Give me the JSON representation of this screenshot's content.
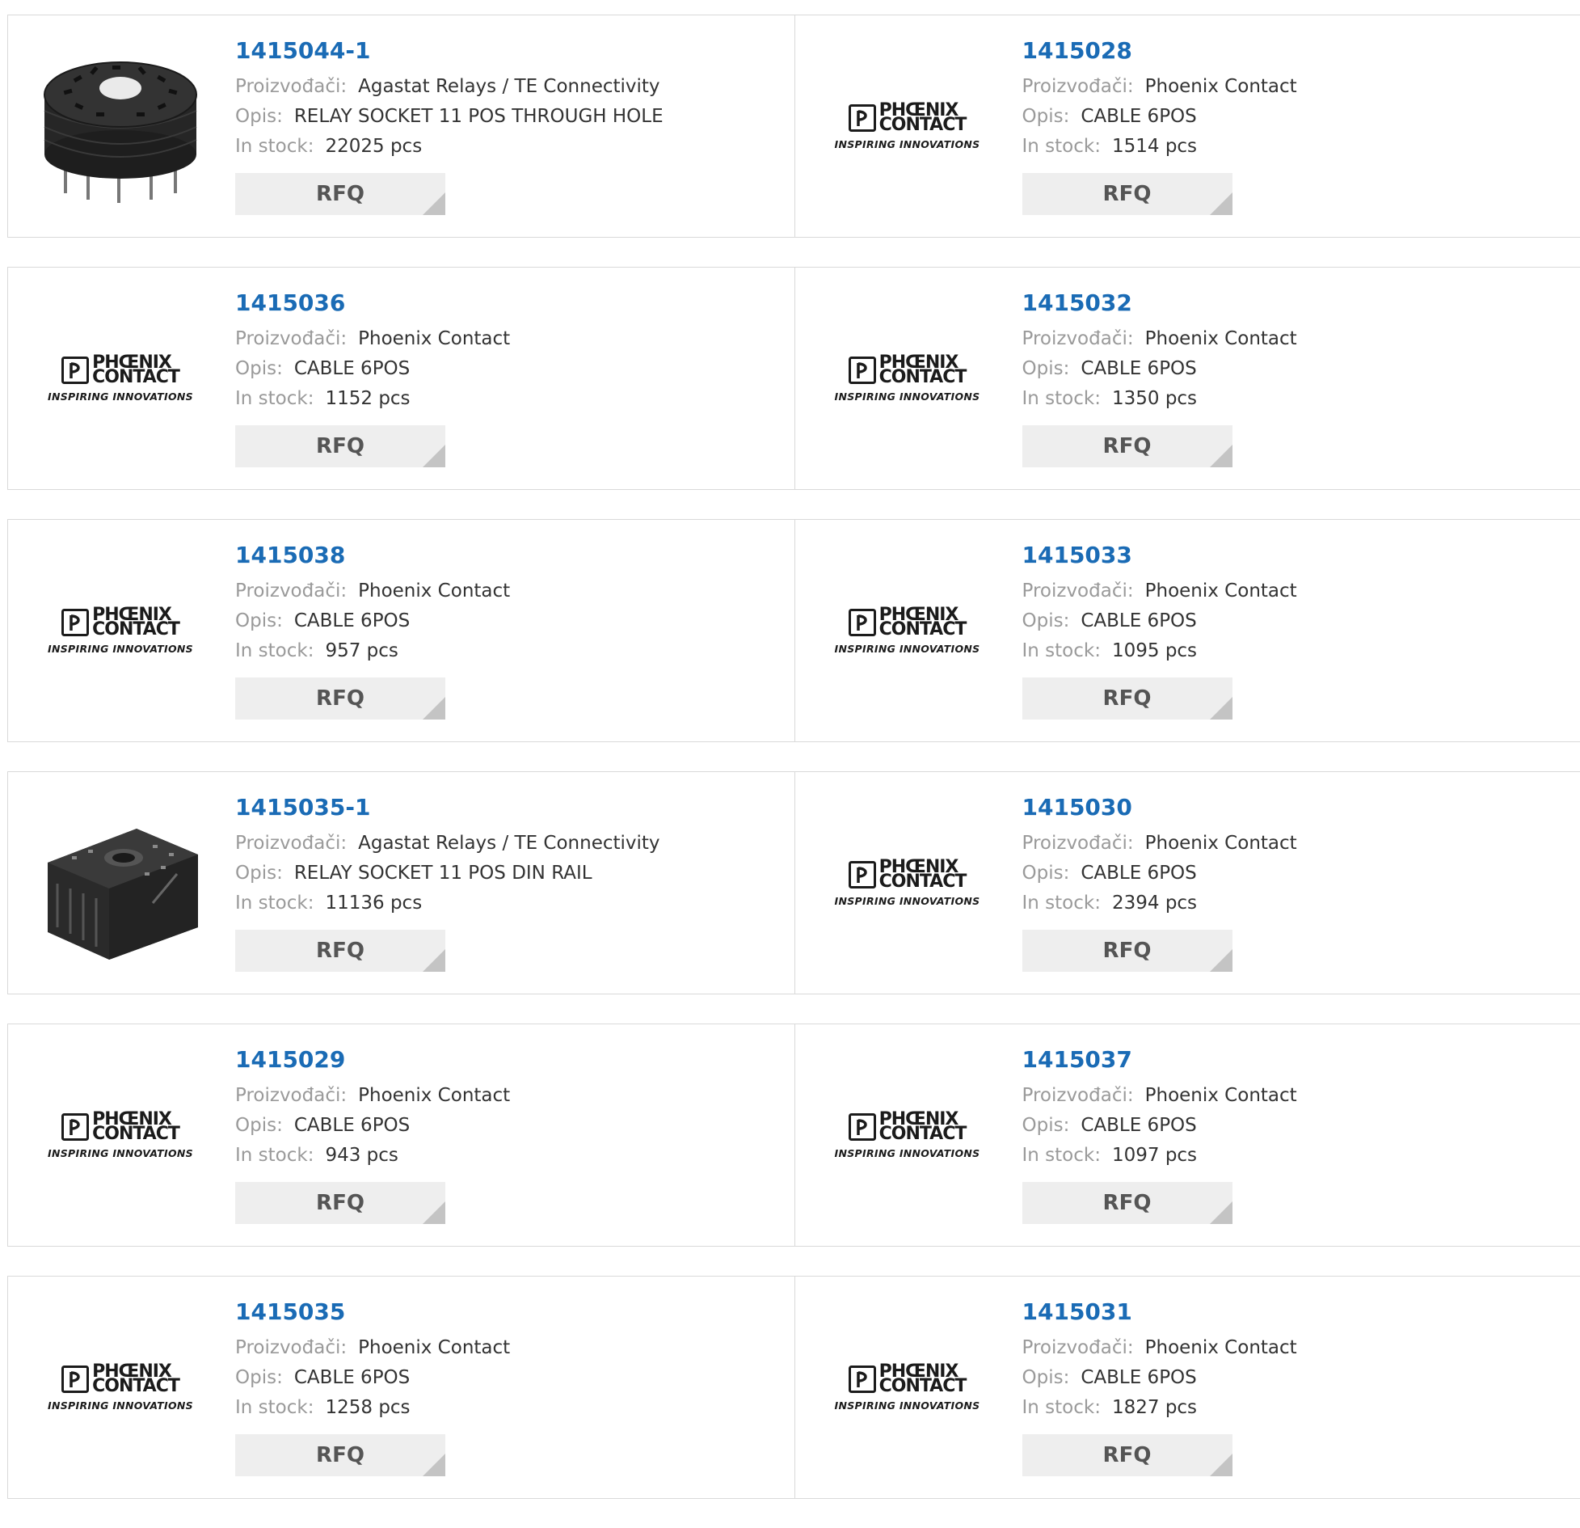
{
  "labels": {
    "manufacturer": "Proizvođači:",
    "description": "Opis:",
    "stock": "In stock:",
    "rfq": "RFQ"
  },
  "logo": {
    "brand_line1": "PHŒNIX",
    "brand_line2": "CONTACT",
    "tagline": "INSPIRING INNOVATIONS"
  },
  "products": [
    {
      "part_number": "1415044-1",
      "manufacturer": "Agastat Relays / TE Connectivity",
      "description": "RELAY SOCKET 11 POS THROUGH HOLE",
      "stock": "22025 pcs",
      "image": "relay-socket-round"
    },
    {
      "part_number": "1415028",
      "manufacturer": "Phoenix Contact",
      "description": "CABLE 6POS",
      "stock": "1514 pcs",
      "image": "phoenix-logo"
    },
    {
      "part_number": "1415036",
      "manufacturer": "Phoenix Contact",
      "description": "CABLE 6POS",
      "stock": "1152 pcs",
      "image": "phoenix-logo"
    },
    {
      "part_number": "1415032",
      "manufacturer": "Phoenix Contact",
      "description": "CABLE 6POS",
      "stock": "1350 pcs",
      "image": "phoenix-logo"
    },
    {
      "part_number": "1415038",
      "manufacturer": "Phoenix Contact",
      "description": "CABLE 6POS",
      "stock": "957 pcs",
      "image": "phoenix-logo"
    },
    {
      "part_number": "1415033",
      "manufacturer": "Phoenix Contact",
      "description": "CABLE 6POS",
      "stock": "1095 pcs",
      "image": "phoenix-logo"
    },
    {
      "part_number": "1415035-1",
      "manufacturer": "Agastat Relays / TE Connectivity",
      "description": "RELAY SOCKET 11 POS DIN RAIL",
      "stock": "11136 pcs",
      "image": "relay-socket-din"
    },
    {
      "part_number": "1415030",
      "manufacturer": "Phoenix Contact",
      "description": "CABLE 6POS",
      "stock": "2394 pcs",
      "image": "phoenix-logo"
    },
    {
      "part_number": "1415029",
      "manufacturer": "Phoenix Contact",
      "description": "CABLE 6POS",
      "stock": "943 pcs",
      "image": "phoenix-logo"
    },
    {
      "part_number": "1415037",
      "manufacturer": "Phoenix Contact",
      "description": "CABLE 6POS",
      "stock": "1097 pcs",
      "image": "phoenix-logo"
    },
    {
      "part_number": "1415035",
      "manufacturer": "Phoenix Contact",
      "description": "CABLE 6POS",
      "stock": "1258 pcs",
      "image": "phoenix-logo"
    },
    {
      "part_number": "1415031",
      "manufacturer": "Phoenix Contact",
      "description": "CABLE 6POS",
      "stock": "1827 pcs",
      "image": "phoenix-logo"
    }
  ],
  "colors": {
    "part_link": "#1a6bb5",
    "label": "#9a9a9a",
    "value": "#333333",
    "button_bg": "#eeeeee",
    "border": "#d9d9d9"
  }
}
